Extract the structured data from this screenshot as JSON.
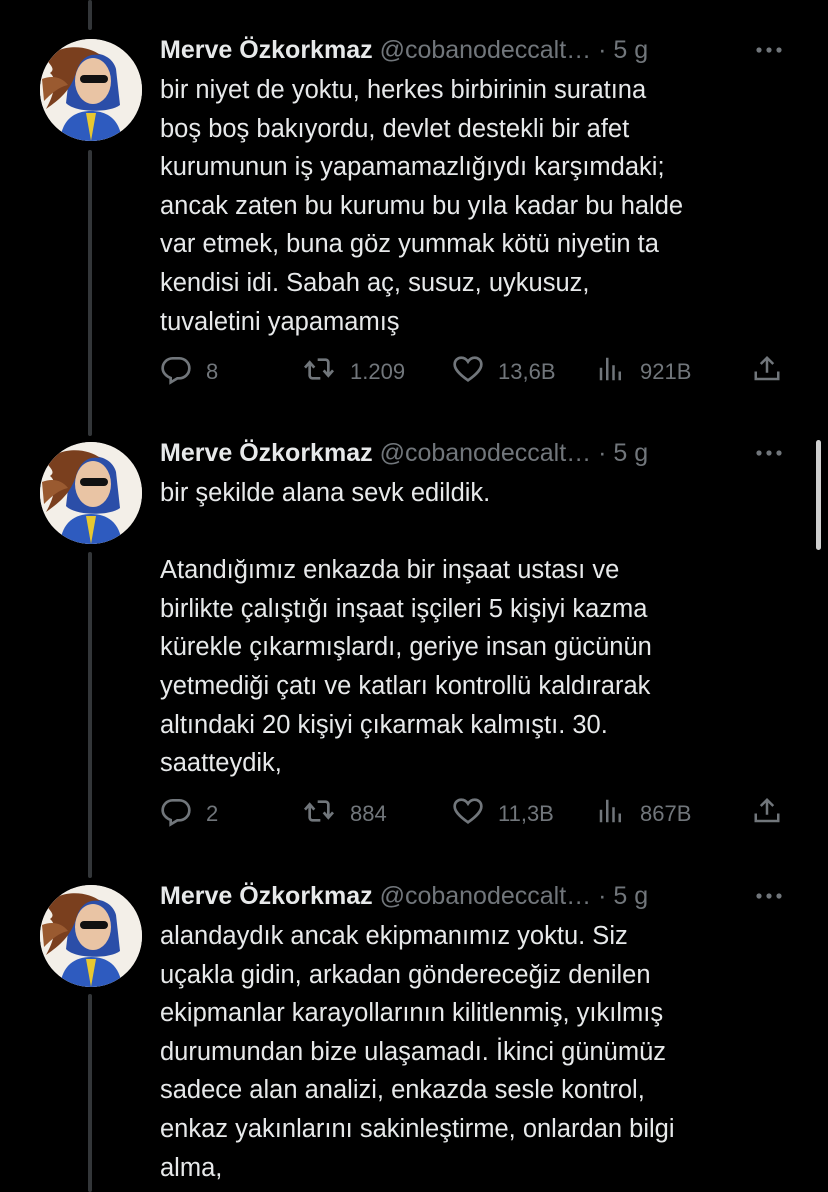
{
  "tweets": [
    {
      "author_name": "Merve Özkorkmaz",
      "handle": "@cobanodeccalt…",
      "dot": "·",
      "time": "5 g",
      "text": "bir niyet de yoktu, herkes birbirinin suratına\nboş boş bakıyordu, devlet destekli bir afet\nkurumunun iş yapamamazlığıydı karşımdaki;\nancak zaten bu kurumu bu yıla kadar bu halde\nvar etmek, buna göz yummak kötü niyetin ta\nkendisi idi. Sabah aç, susuz, uykusuz,\ntuvaletini yapamamış",
      "replies": "8",
      "retweets": "1.209",
      "likes": "13,6B",
      "views": "921B"
    },
    {
      "author_name": "Merve Özkorkmaz",
      "handle": "@cobanodeccalt…",
      "dot": "·",
      "time": "5 g",
      "text": "bir şekilde alana sevk edildik.\n\nAtandığımız enkazda bir inşaat ustası ve\nbirlikte çalıştığı inşaat işçileri 5 kişiyi kazma\nkürekle çıkarmışlardı, geriye insan gücünün\nyetmediği çatı ve katları kontrollü kaldırarak\naltındaki 20 kişiyi çıkarmak kalmıştı. 30.\nsaatteydik,",
      "replies": "2",
      "retweets": "884",
      "likes": "11,3B",
      "views": "867B"
    },
    {
      "author_name": "Merve Özkorkmaz",
      "handle": "@cobanodeccalt…",
      "dot": "·",
      "time": "5 g",
      "text": "alandaydık ancak ekipmanımız yoktu. Siz\nuçakla gidin, arkadan göndereceğiz denilen\nekipmanlar karayollarının kilitlenmiş, yıkılmış\ndurumundan bize ulaşamadı. İkinci günümüz\nsadece alan analizi, enkazda sesle kontrol,\nenkaz yakınlarını sakinleştirme, onlardan bilgi\nalma,"
    }
  ],
  "icons": {
    "more": "more-icon",
    "reply": "reply-icon",
    "retweet": "retweet-icon",
    "like": "like-icon",
    "views": "views-icon",
    "share": "share-icon"
  },
  "colors": {
    "background": "#000000",
    "text": "#e7e9ea",
    "muted": "#71767b",
    "thread_line": "#333639"
  }
}
